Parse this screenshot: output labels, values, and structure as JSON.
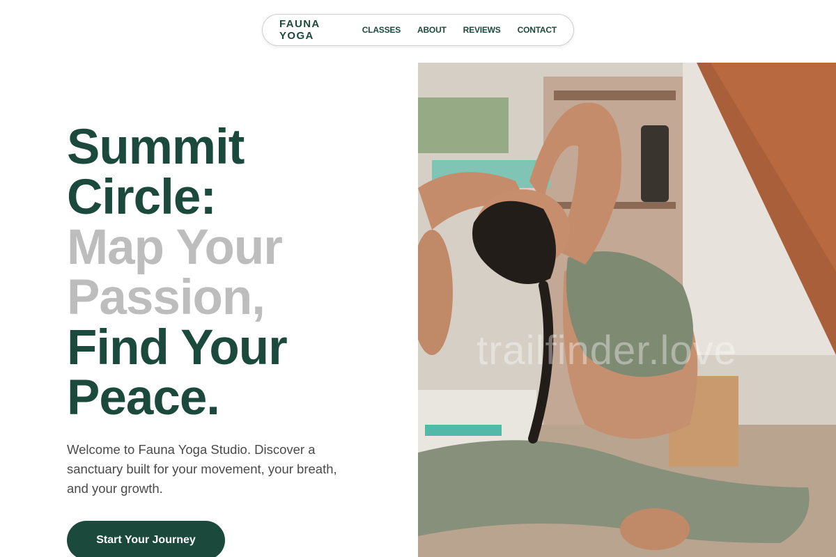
{
  "nav": {
    "brand": "FAUNA YOGA",
    "links": [
      "CLASSES",
      "ABOUT",
      "REVIEWS",
      "CONTACT"
    ]
  },
  "hero": {
    "title_lines": [
      {
        "text": "Summit",
        "tone": "dark"
      },
      {
        "text": "Circle:",
        "tone": "dark"
      },
      {
        "text": "Map Your",
        "tone": "grey"
      },
      {
        "text": "Passion,",
        "tone": "grey"
      },
      {
        "text": "Find Your",
        "tone": "dark"
      },
      {
        "text": "Peace.",
        "tone": "dark"
      }
    ],
    "intro": "Welcome to Fauna Yoga Studio. Discover a sanctuary built for your movement, your breath, and your growth.",
    "cta_label": "Start Your Journey",
    "image_watermark": "trailfinder.love"
  },
  "colors": {
    "brand_green": "#1b4a3d",
    "muted_grey": "#bdbdbd",
    "body_text": "#4a4a4a"
  }
}
